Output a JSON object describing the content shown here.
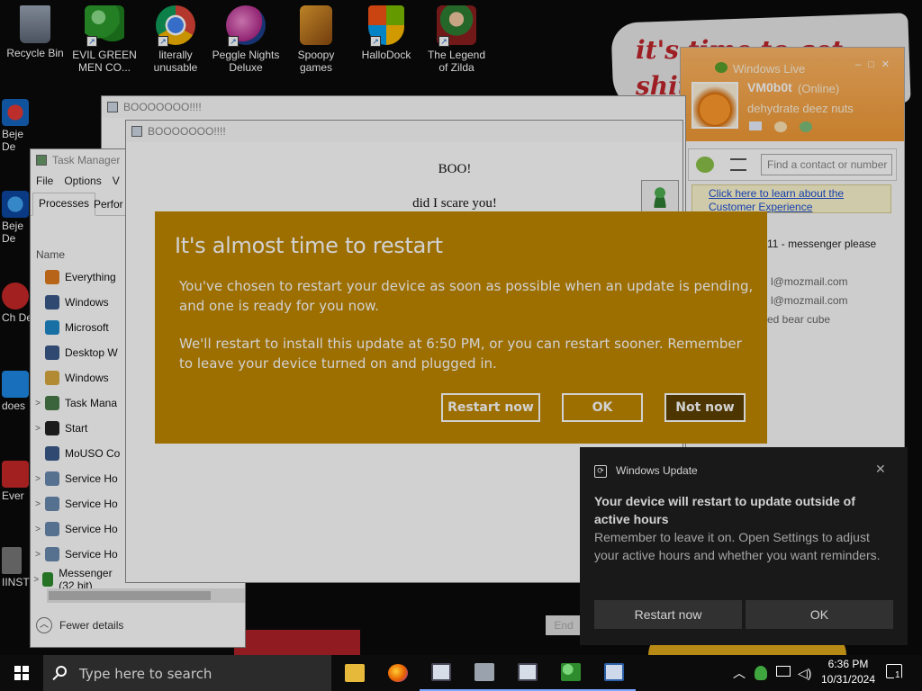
{
  "desktop": {
    "icons": [
      {
        "label": "Recycle Bin",
        "icon": "recycle-bin-icon"
      },
      {
        "label": "EVIL GREEN MEN CO...",
        "icon": "messenger-people-icon"
      },
      {
        "label": "literally unusable",
        "icon": "chrome-icon"
      },
      {
        "label": "Peggle Nights Deluxe",
        "icon": "peggle-icon"
      },
      {
        "label": "Spoopy games",
        "icon": "folder-icon"
      },
      {
        "label": "HalloDock",
        "icon": "windows-flag-icon"
      },
      {
        "label": "The Legend of Zilda",
        "icon": "zilda-icon"
      }
    ],
    "left_icons": [
      {
        "label": "Beje De"
      },
      {
        "label": "Beje De"
      },
      {
        "label": "Ch De"
      },
      {
        "label": "does"
      },
      {
        "label": "Ever"
      },
      {
        "label": "IINST"
      }
    ],
    "wallpaper_text": "it's time to get shit and"
  },
  "boo_windows": {
    "back_title": "BOOOOOOO!!!!",
    "front_title": "BOOOOOOO!!!!",
    "heading": "BOO!",
    "line": "did I scare you!"
  },
  "task_manager": {
    "title": "Task Manager",
    "menu": [
      "File",
      "Options",
      "V"
    ],
    "tabs": [
      "Processes",
      "Perfor"
    ],
    "column_name": "Name",
    "rows": [
      {
        "label": "Everything",
        "expand": false,
        "color": "#e07a1f"
      },
      {
        "label": "Windows",
        "expand": false,
        "color": "#3a5a8a"
      },
      {
        "label": "Microsoft",
        "expand": false,
        "color": "#1e88c8"
      },
      {
        "label": "Desktop W",
        "expand": false,
        "color": "#3a5a8a"
      },
      {
        "label": "Windows",
        "expand": false,
        "color": "#d9a940"
      },
      {
        "label": "Task Mana",
        "expand": true,
        "color": "#4a7a4a"
      },
      {
        "label": "Start",
        "expand": true,
        "color": "#222222"
      },
      {
        "label": "MoUSO Co",
        "expand": false,
        "color": "#3a5a8a"
      },
      {
        "label": "Service Ho",
        "expand": true,
        "color": "#6a8ab0"
      },
      {
        "label": "Service Ho",
        "expand": true,
        "color": "#6a8ab0"
      },
      {
        "label": "Service Ho",
        "expand": true,
        "color": "#6a8ab0"
      },
      {
        "label": "Service Ho",
        "expand": true,
        "color": "#6a8ab0"
      },
      {
        "label": "Messenger (32 bit)",
        "expand": true,
        "color": "#2e8b2e"
      }
    ],
    "fewer_details": "Fewer details",
    "end_task": "End"
  },
  "messenger": {
    "title": "Windows Live",
    "username": "VM0b0t",
    "status": "(Online)",
    "personal_message": "dehydrate deez nuts",
    "search_placeholder": "Find a contact or number",
    "info_link": "Click here to learn about the Customer Experience",
    "contact_1": "11 - messenger please",
    "contact_2": "l@mozmail.com",
    "contact_3": "l@mozmail.com",
    "contact_4": "ed bear cube"
  },
  "restart_dialog": {
    "title": "It's almost time to restart",
    "para1": "You've chosen to restart your device as soon as possible when an update is pending, and one is ready for you now.",
    "para2": "We'll restart to install this update at 6:50 PM, or you can restart sooner. Remember to leave your device turned on and plugged in.",
    "restart_now": "Restart now",
    "ok": "OK",
    "not_now": "Not now",
    "accent": "#c08700"
  },
  "toast": {
    "app_name": "Windows Update",
    "title": "Your device will restart to update outside of active hours",
    "body": "Remember to leave it on. Open Settings to adjust your active hours and whether you want reminders.",
    "restart_now": "Restart now",
    "ok": "OK"
  },
  "taskbar": {
    "search_placeholder": "Type here to search",
    "time": "6:36 PM",
    "date": "10/31/2024",
    "notification_count": "1"
  }
}
